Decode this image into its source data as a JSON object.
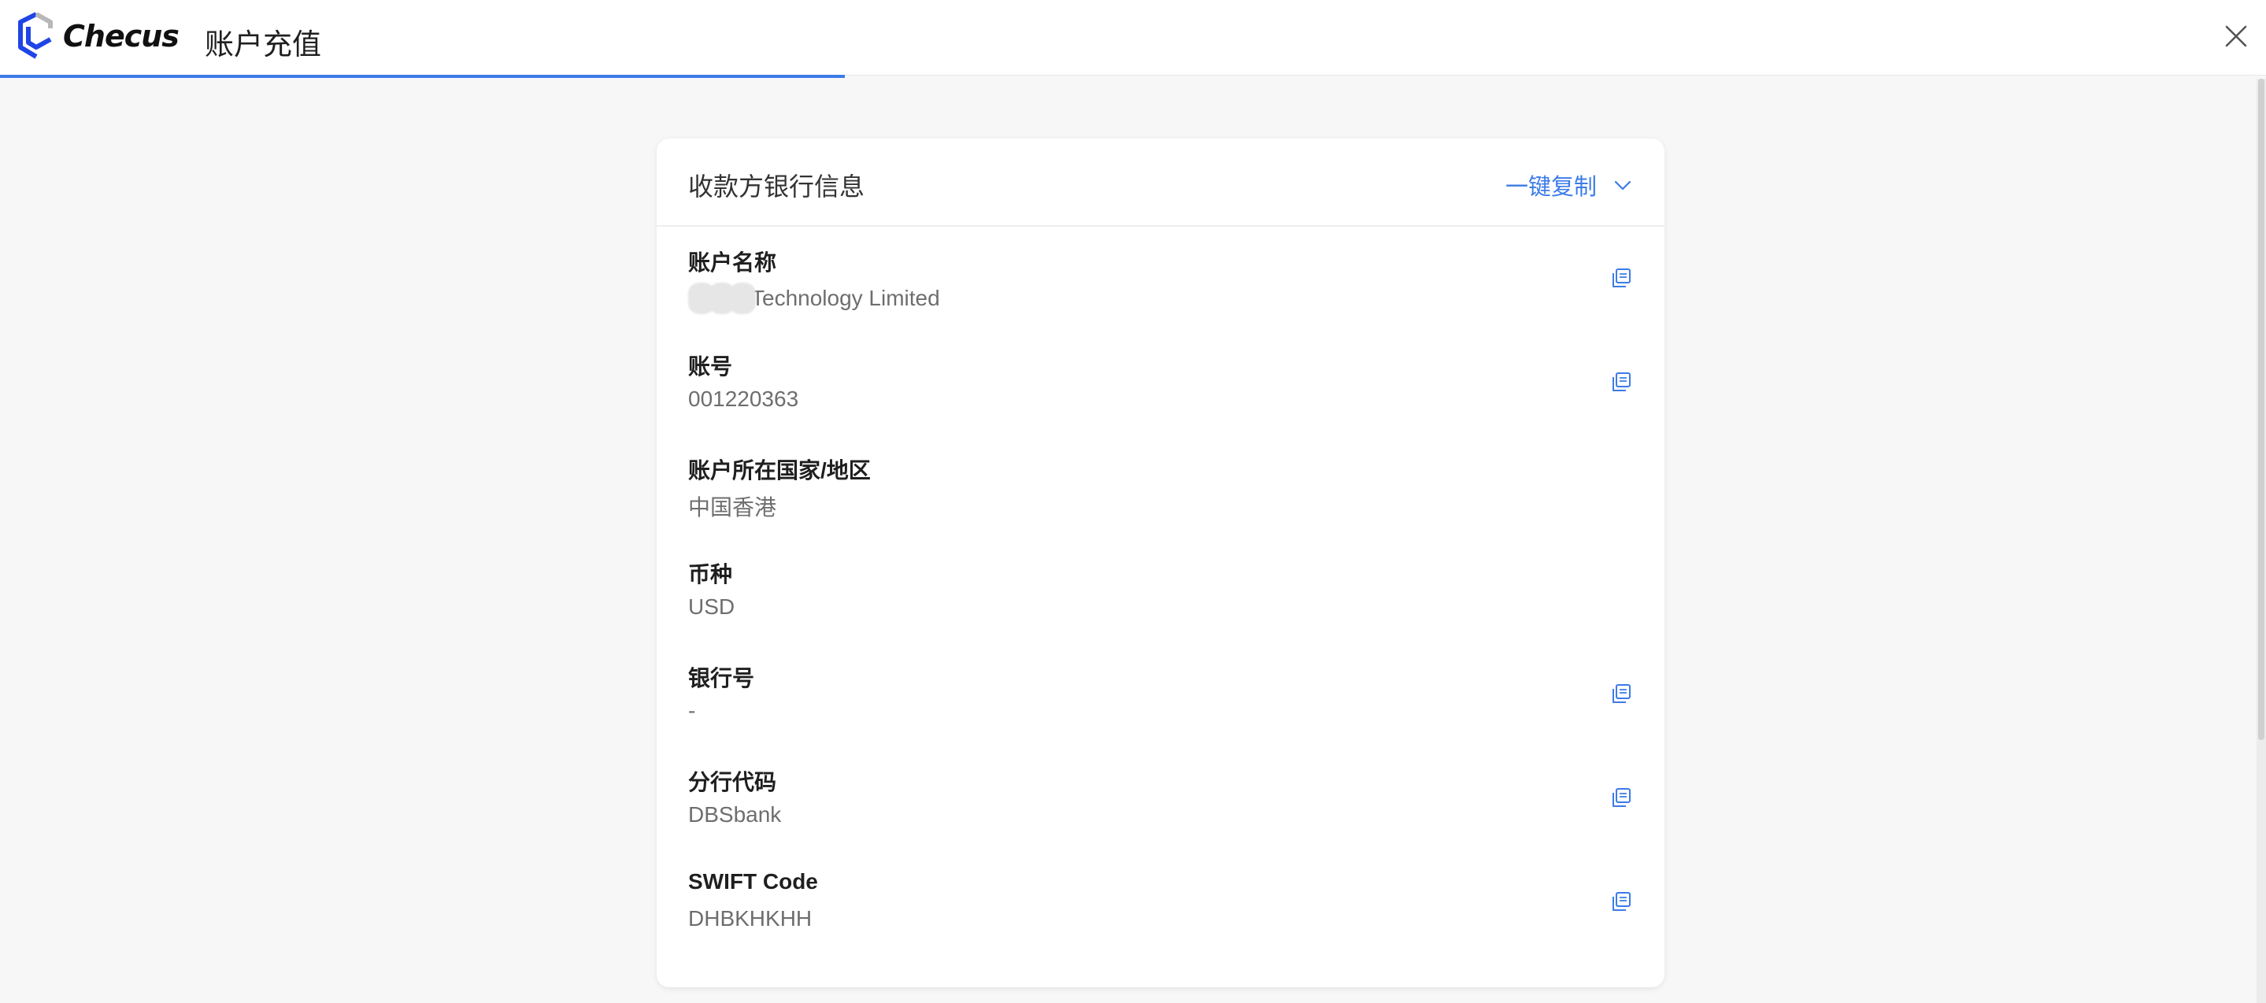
{
  "app": {
    "logo_text": "Checus",
    "title": "账户充值",
    "progress_fraction": 0.373
  },
  "colors": {
    "accent": "#3c7be8",
    "logo_blue": "#1f45e6",
    "logo_gray": "#b8b8b8",
    "label": "#1f1f1f",
    "value": "#6e6e6e"
  },
  "card": {
    "title": "收款方银行信息",
    "copy_all_label": "一键复制",
    "rows": [
      {
        "label": "账户名称",
        "value": "Technology Limited",
        "has_copy": true
      },
      {
        "label": "账号",
        "value": "001220363",
        "has_copy": true
      },
      {
        "label": "账户所在国家/地区",
        "value": "中国香港",
        "has_copy": false
      },
      {
        "label": "币种",
        "value": "USD",
        "has_copy": false
      },
      {
        "label": "银行号",
        "value": "-",
        "has_copy": true
      },
      {
        "label": "分行代码",
        "value": "DBSbank",
        "has_copy": true
      },
      {
        "label": "SWIFT Code",
        "value": "DHBKHKHH",
        "has_copy": true
      }
    ]
  },
  "icons": {
    "close": "close-icon",
    "chevron": "chevron-down-icon",
    "copy": "copy-icon"
  }
}
